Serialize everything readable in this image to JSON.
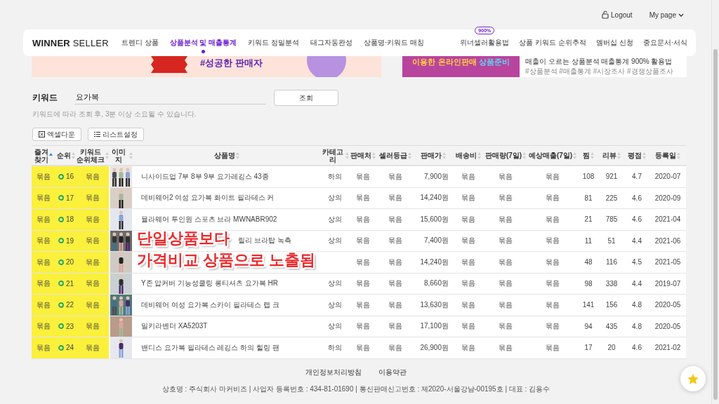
{
  "top_bar": {
    "logout": "Logout",
    "my_page": "My page"
  },
  "nav": {
    "logo_bold": "WINNER",
    "logo_light": "SELLER",
    "items": [
      {
        "label": "트렌디 상품",
        "selected": false
      },
      {
        "label": "상품분석 및 매출통계",
        "selected": true
      },
      {
        "label": "키워드 정밀분석",
        "selected": false
      },
      {
        "label": "태그자동완성",
        "selected": false
      },
      {
        "label": "상품명·키워드 매칭",
        "selected": false
      }
    ],
    "right_items": [
      {
        "label": "위너셀러활용법",
        "badge": "900%"
      },
      {
        "label": "상품 키워드 순위추적"
      },
      {
        "label": "멤버십 신청"
      },
      {
        "label": "중요문서·서식"
      }
    ]
  },
  "banners": {
    "left_text": "#성공한 판매자",
    "right_promo_1": "이용한 온라인판매",
    "right_promo_2": "상품준비",
    "right_title": "매출이 오르는 상품분석 매출통계 900% 활용법",
    "right_tags": "#상품분석 #매출통계 #시장조사 #경쟁상품조사"
  },
  "search": {
    "label": "키워드",
    "value": "요가복",
    "button": "조회",
    "hint": "키워드에 따라 조회 후, 3분 이상 소요될 수 있습니다."
  },
  "toolbar": [
    "엑셀다운",
    "리스트설정"
  ],
  "table": {
    "columns": [
      {
        "label": "즐겨찾기",
        "sorted": true
      },
      {
        "label": "순위",
        "sorted": false
      },
      {
        "label": "키워드 순위체크",
        "sorted": false
      },
      {
        "label": "이미지",
        "sorted": false
      },
      {
        "label": "상품명",
        "sorted": false
      },
      {
        "label": "카테고리",
        "sorted": false
      },
      {
        "label": "판매처",
        "sorted": false
      },
      {
        "label": "셀러등급",
        "sorted": false
      },
      {
        "label": "판매가",
        "sorted": false
      },
      {
        "label": "배송비",
        "sorted": false
      },
      {
        "label": "판매량(7일)",
        "sorted": false
      },
      {
        "label": "예상매출(7일)",
        "sorted": false
      },
      {
        "label": "찜",
        "sorted": false
      },
      {
        "label": "리뷰",
        "sorted": false
      },
      {
        "label": "평점",
        "sorted": false
      },
      {
        "label": "등록일",
        "sorted": false
      }
    ],
    "rows": [
      {
        "favorite": "묶음",
        "rank": "16",
        "keyword_check": "묶음",
        "name": "니사이드업 7부 8부 9부 요가레깅스 43종",
        "name_covered": false,
        "category": "하의",
        "seller": "묶음",
        "grade": "묶음",
        "price": "7,900원",
        "shipping": "묶음",
        "sales": "묶음",
        "revenue": "묶음",
        "likes": "108",
        "reviews": "921",
        "rating": "4.7",
        "date": "2020-07"
      },
      {
        "favorite": "묶음",
        "rank": "17",
        "keyword_check": "묶음",
        "name": "데비웨어2 여성 요가복 화이트 필라테스 커",
        "name_covered": false,
        "category": "상의",
        "seller": "묶음",
        "grade": "묶음",
        "price": "14,240원",
        "shipping": "묶음",
        "sales": "묶음",
        "revenue": "묶음",
        "likes": "81",
        "reviews": "225",
        "rating": "4.6",
        "date": "2020-09"
      },
      {
        "favorite": "묶음",
        "rank": "18",
        "keyword_check": "묶음",
        "name": "뮬라웨어 투인원 스포츠 브라 MWNABR902",
        "name_covered": false,
        "category": "상의",
        "seller": "묶음",
        "grade": "묶음",
        "price": "15,600원",
        "shipping": "묶음",
        "sales": "묶음",
        "revenue": "묶음",
        "likes": "21",
        "reviews": "785",
        "rating": "4.6",
        "date": "2021-04"
      },
      {
        "favorite": "묶음",
        "rank": "19",
        "keyword_check": "묶음",
        "name": "릴리 브라탑 녹측",
        "name_covered": true,
        "category": "상의",
        "seller": "묶음",
        "grade": "묶음",
        "price": "7,400원",
        "shipping": "묶음",
        "sales": "묶음",
        "revenue": "묶음",
        "likes": "11",
        "reviews": "51",
        "rating": "4.4",
        "date": "2021-06"
      },
      {
        "favorite": "묶음",
        "rank": "20",
        "keyword_check": "묶음",
        "seller": "묶음",
        "grade": "묶음",
        "price": "14,240원",
        "shipping": "묶음",
        "sales": "묶음",
        "revenue": "묶음",
        "likes": "48",
        "reviews": "116",
        "rating": "4.5",
        "date": "2021-05"
      },
      {
        "favorite": "묶음",
        "rank": "21",
        "keyword_check": "묶음",
        "name": "Y존 압커버 기능성쿨링 롱티셔츠 요가복 HR",
        "name_covered": false,
        "category": "상의",
        "seller": "묶음",
        "grade": "묶음",
        "price": "8,660원",
        "shipping": "묶음",
        "sales": "묶음",
        "revenue": "묶음",
        "likes": "98",
        "reviews": "338",
        "rating": "4.4",
        "date": "2019-07"
      },
      {
        "favorite": "묶음",
        "rank": "22",
        "keyword_check": "묶음",
        "name": "데비웨어 여성 요가복 스카이 필라테스 랩 크",
        "name_covered": false,
        "category": "상의",
        "seller": "묶음",
        "grade": "묶음",
        "price": "13,630원",
        "shipping": "묶음",
        "sales": "묶음",
        "revenue": "묶음",
        "likes": "141",
        "reviews": "156",
        "rating": "4.8",
        "date": "2020-05"
      },
      {
        "favorite": "묶음",
        "rank": "23",
        "keyword_check": "묶음",
        "name": "밀키라벤더 XA5203T",
        "name_covered": false,
        "category": "상의",
        "seller": "묶음",
        "grade": "묶음",
        "price": "17,100원",
        "shipping": "묶음",
        "sales": "묶음",
        "revenue": "묶음",
        "likes": "94",
        "reviews": "435",
        "rating": "4.8",
        "date": "2020-05"
      },
      {
        "favorite": "묶음",
        "rank": "24",
        "keyword_check": "묶음",
        "name": "밴디스 요가복 필라테스 레깅스 하의 힐링 팬",
        "name_covered": false,
        "category": "하의",
        "seller": "묶음",
        "grade": "묶음",
        "price": "26,900원",
        "shipping": "묶음",
        "sales": "묶음",
        "revenue": "묶음",
        "likes": "17",
        "reviews": "20",
        "rating": "4.6",
        "date": "2021-02"
      }
    ]
  },
  "overlay_caption": [
    "단일상품보다",
    "가격비교 상품으로 노출됨"
  ],
  "footer": {
    "links": [
      "개인정보처리방침",
      "이용약관"
    ],
    "info": "상호명 : 주식회사 마커비즈 | 사업자 등록번호 : 434-81-01690 | 통신판매신고번호 : 제2020-서울강남-00195호 | 대표 : 김용수"
  }
}
